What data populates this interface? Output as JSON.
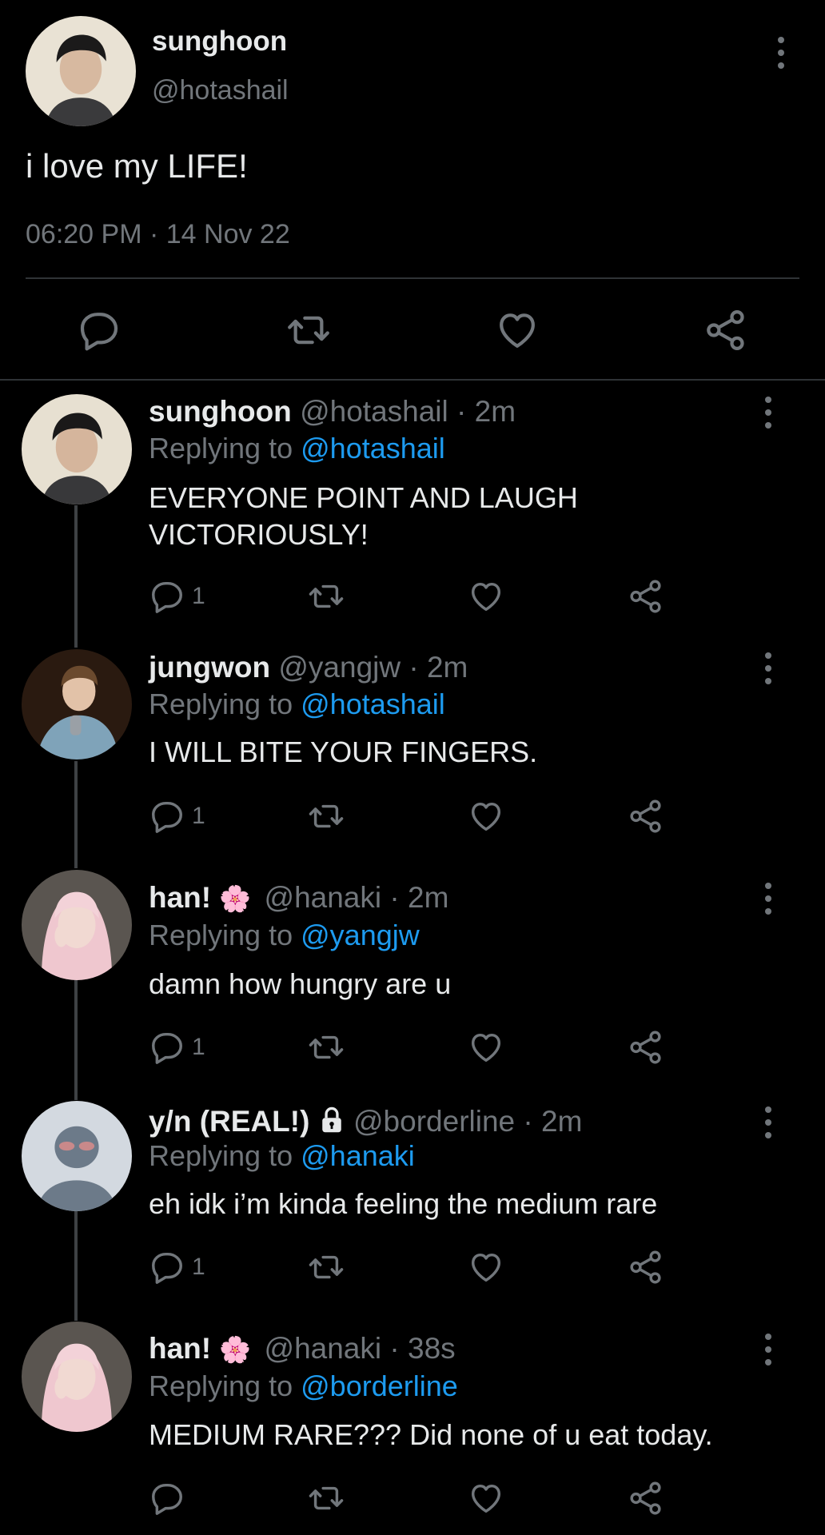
{
  "main_tweet": {
    "display_name": "sunghoon",
    "handle": "@hotashail",
    "text": "i love my LIFE!",
    "timestamp": "06:20 PM · 14 Nov 22"
  },
  "replies": [
    {
      "display_name": "sunghoon",
      "meta": "@hotashail · 2m",
      "replying_prefix": "Replying to",
      "replying_to": "@hotashail",
      "text_line1": "EVERYONE POINT AND LAUGH",
      "text_line2": "VICTORIOUSLY!",
      "reply_count": "1"
    },
    {
      "display_name": "jungwon",
      "meta": "@yangjw · 2m",
      "replying_prefix": "Replying to",
      "replying_to": "@hotashail",
      "text": "I WILL BITE YOUR FINGERS.",
      "reply_count": "1"
    },
    {
      "display_name": "han!",
      "emoji": "🌸",
      "meta": "@hanaki · 2m",
      "replying_prefix": "Replying to",
      "replying_to": "@yangjw",
      "text": "damn how hungry are u",
      "reply_count": "1"
    },
    {
      "display_name": "y/n (REAL!)",
      "meta": "@borderline · 2m",
      "replying_prefix": "Replying to",
      "replying_to": "@hanaki",
      "text": "eh idk i’m kinda feeling the medium rare",
      "reply_count": "1"
    },
    {
      "display_name": "han!",
      "emoji": "🌸",
      "meta": "@hanaki · 38s",
      "replying_prefix": "Replying to",
      "replying_to": "@borderline",
      "text": "MEDIUM RARE??? Did none of u eat today."
    }
  ],
  "colors": {
    "background": "#000000",
    "text": "#e7e9ea",
    "muted": "#71767b",
    "link": "#1d9bf0"
  }
}
